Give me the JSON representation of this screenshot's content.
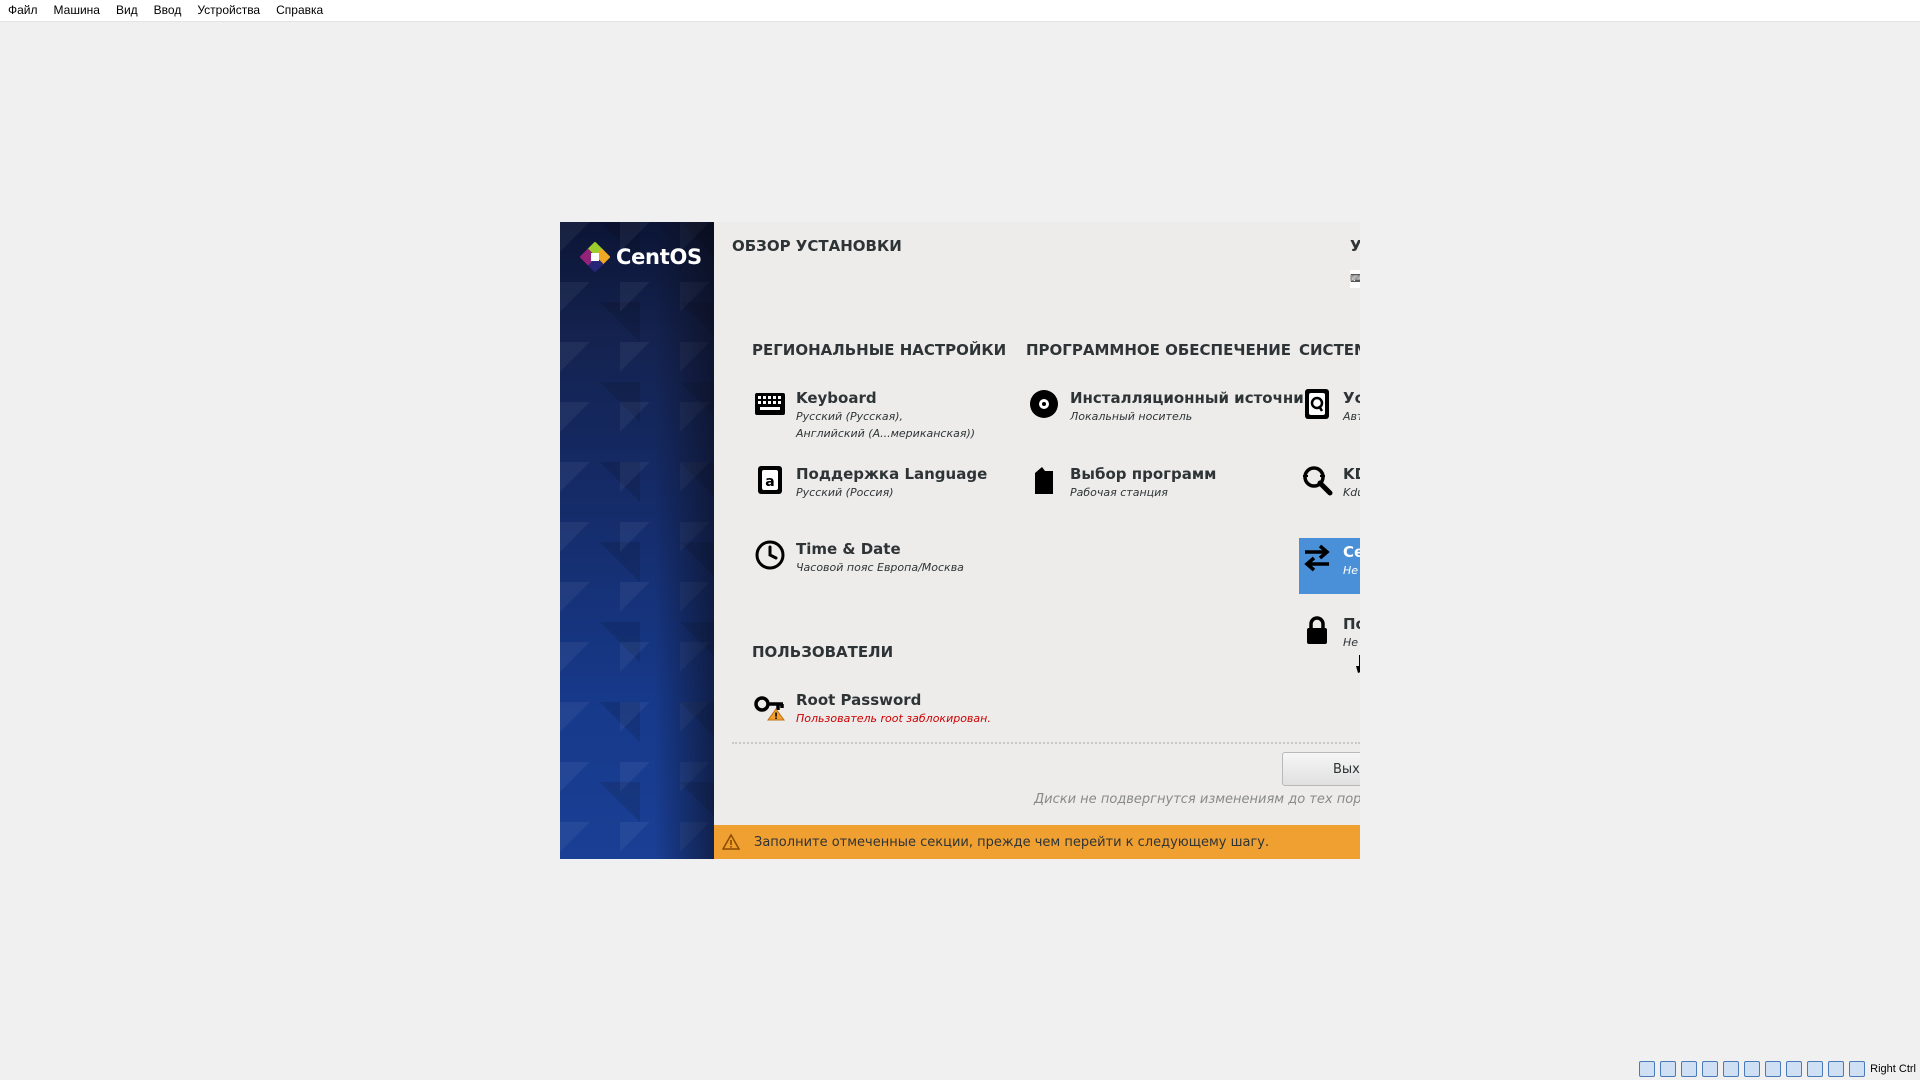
{
  "host_menu": {
    "items": [
      "Файл",
      "Машина",
      "Вид",
      "Ввод",
      "Устройства",
      "Справка"
    ]
  },
  "installer": {
    "logo_text": "CentOS",
    "page_title": "ОБЗОР УСТАНОВКИ",
    "corner_letter": "У",
    "corner_chip": "⌨",
    "sections": {
      "localization": {
        "heading": "РЕГИОНАЛЬНЫЕ НАСТРОЙКИ",
        "keyboard": {
          "title": "Keyboard",
          "status_line1": "Русский (Русская),",
          "status_line2": "Английский (А...мериканская))"
        },
        "language": {
          "title": "Поддержка Language",
          "status": "Русский (Россия)"
        },
        "time": {
          "title": "Time & Date",
          "status": "Часовой пояс Европа/Москва"
        }
      },
      "software": {
        "heading": "ПРОГРАММНОЕ ОБЕСПЕЧЕНИЕ",
        "source": {
          "title": "Инсталляционный источник",
          "status": "Локальный носитель"
        },
        "selection": {
          "title": "Выбор программ",
          "status": "Рабочая станция"
        }
      },
      "system": {
        "heading": "СИСТЕМ",
        "destination": {
          "title": "Ус",
          "status": "Авт"
        },
        "kdump": {
          "title": "KD",
          "status": "Kdu"
        },
        "network": {
          "title": "Се",
          "status": "Не"
        },
        "security": {
          "title": "По",
          "status": "Не"
        }
      },
      "users": {
        "heading": "ПОЛЬЗОВАТЕЛИ",
        "root": {
          "title": "Root Password",
          "status": "Пользователь root заблокирован."
        }
      }
    },
    "quit_button": "Выхо",
    "disk_note": "Диски не подвергнутся изменениям до тех пор, пока вы",
    "warning": "Заполните отмеченные секции, прежде чем перейти к следующему шагу."
  },
  "tray": {
    "label": "Right Ctrl"
  }
}
